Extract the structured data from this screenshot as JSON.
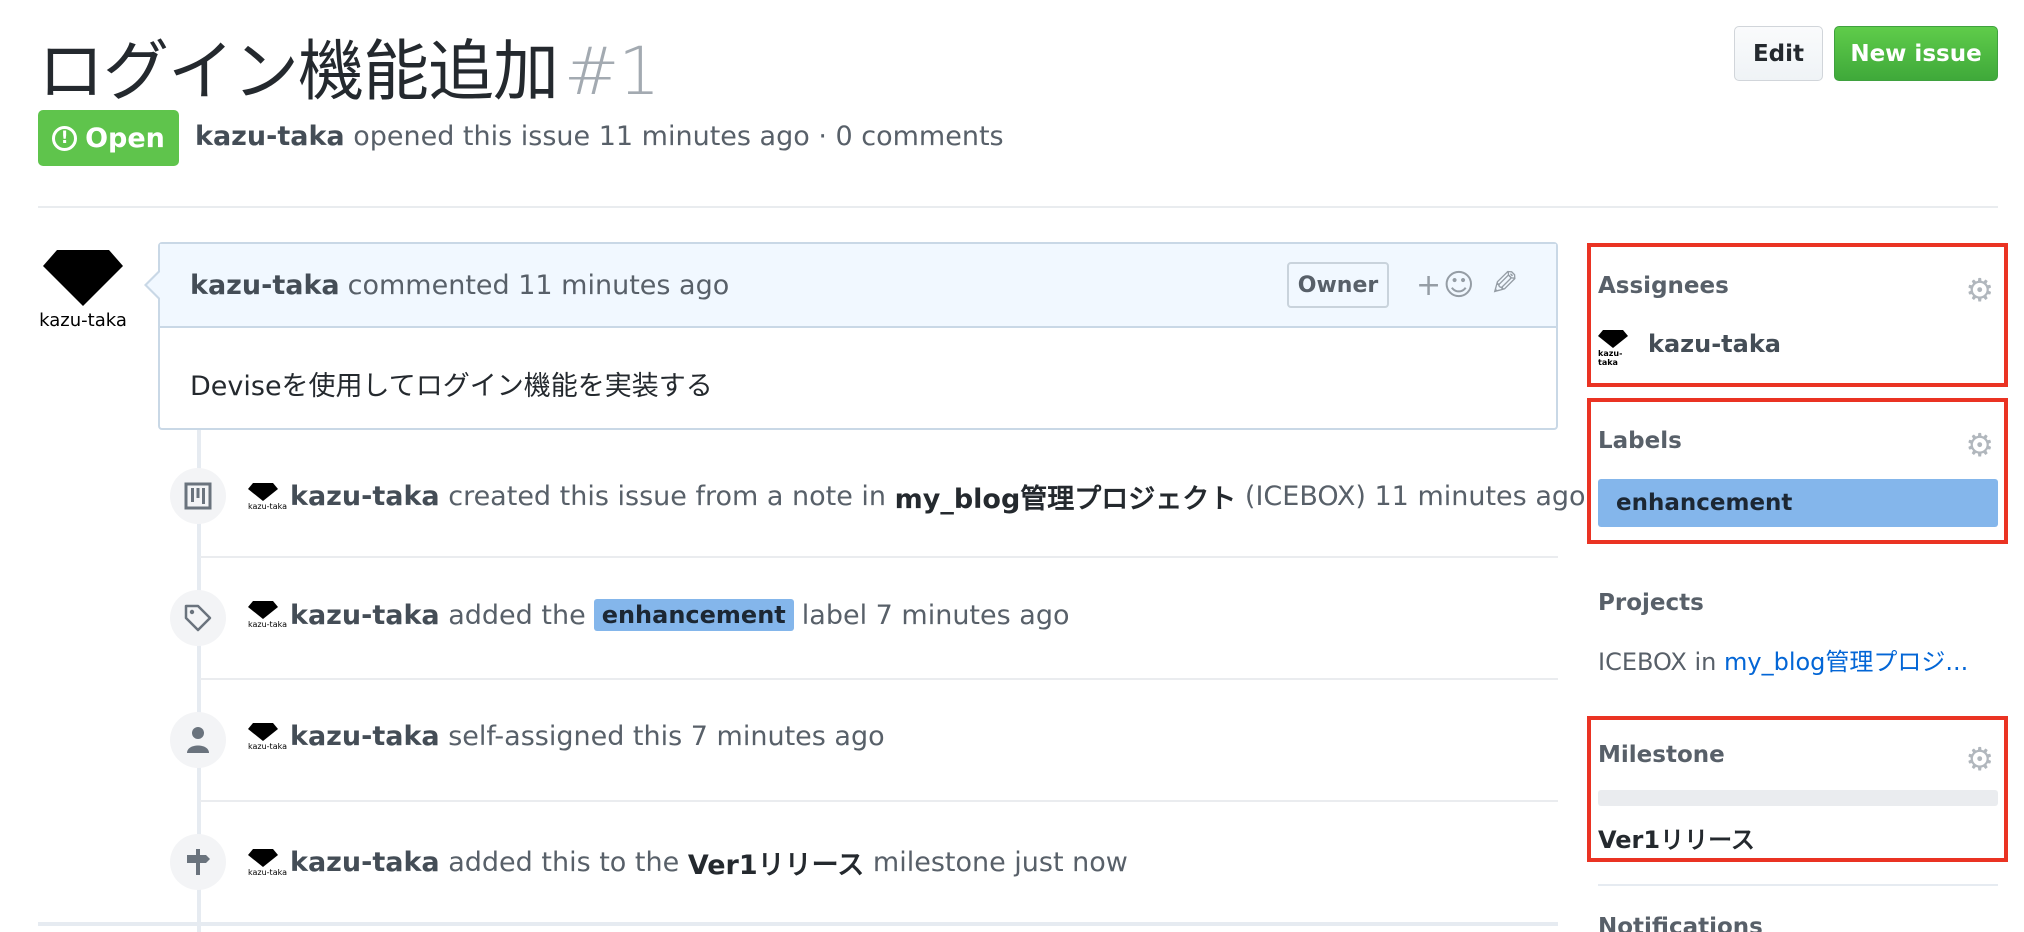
{
  "issue": {
    "title": "ログイン機能追加",
    "number": "#1",
    "state": "Open",
    "author": "kazu-taka",
    "meta_text": "opened this issue 11 minutes ago · 0 comments"
  },
  "actions": {
    "edit_label": "Edit",
    "new_issue_label": "New issue"
  },
  "comment": {
    "author": "kazu-taka",
    "time_text": "commented 11 minutes ago",
    "badge": "Owner",
    "body": "Deviseを使用してログイン機能を実装する",
    "avatar_text": "kazu-taka"
  },
  "events": [
    {
      "icon": "project-icon",
      "user": "kazu-taka",
      "pre": "created this issue from a note in",
      "strong": "my_blog管理プロジェクト",
      "post": "(ICEBOX) 11 minutes ago"
    },
    {
      "icon": "tag-icon",
      "user": "kazu-taka",
      "pre": "added the",
      "label": "enhancement",
      "post": "label 7 minutes ago"
    },
    {
      "icon": "person-icon",
      "user": "kazu-taka",
      "pre": "self-assigned this 7 minutes ago"
    },
    {
      "icon": "milestone-icon",
      "user": "kazu-taka",
      "pre": "added this to the",
      "strong": "Ver1リリース",
      "post": "milestone just now"
    }
  ],
  "mini_avatar_text": "kazu-taka",
  "sidebar": {
    "assignees_title": "Assignees",
    "assignee": "kazu-taka",
    "labels_title": "Labels",
    "label": "enhancement",
    "projects_title": "Projects",
    "project_column": "ICEBOX in",
    "project_link": "my_blog管理プロジ...",
    "milestone_title": "Milestone",
    "milestone_progress": 0,
    "milestone_name": "Ver1リリース",
    "notifications_title": "Notifications"
  },
  "colors": {
    "open_green": "#5fc44c",
    "label_blue": "#84b6eb",
    "highlight_red": "#ea3323",
    "link_blue": "#0366d6"
  }
}
